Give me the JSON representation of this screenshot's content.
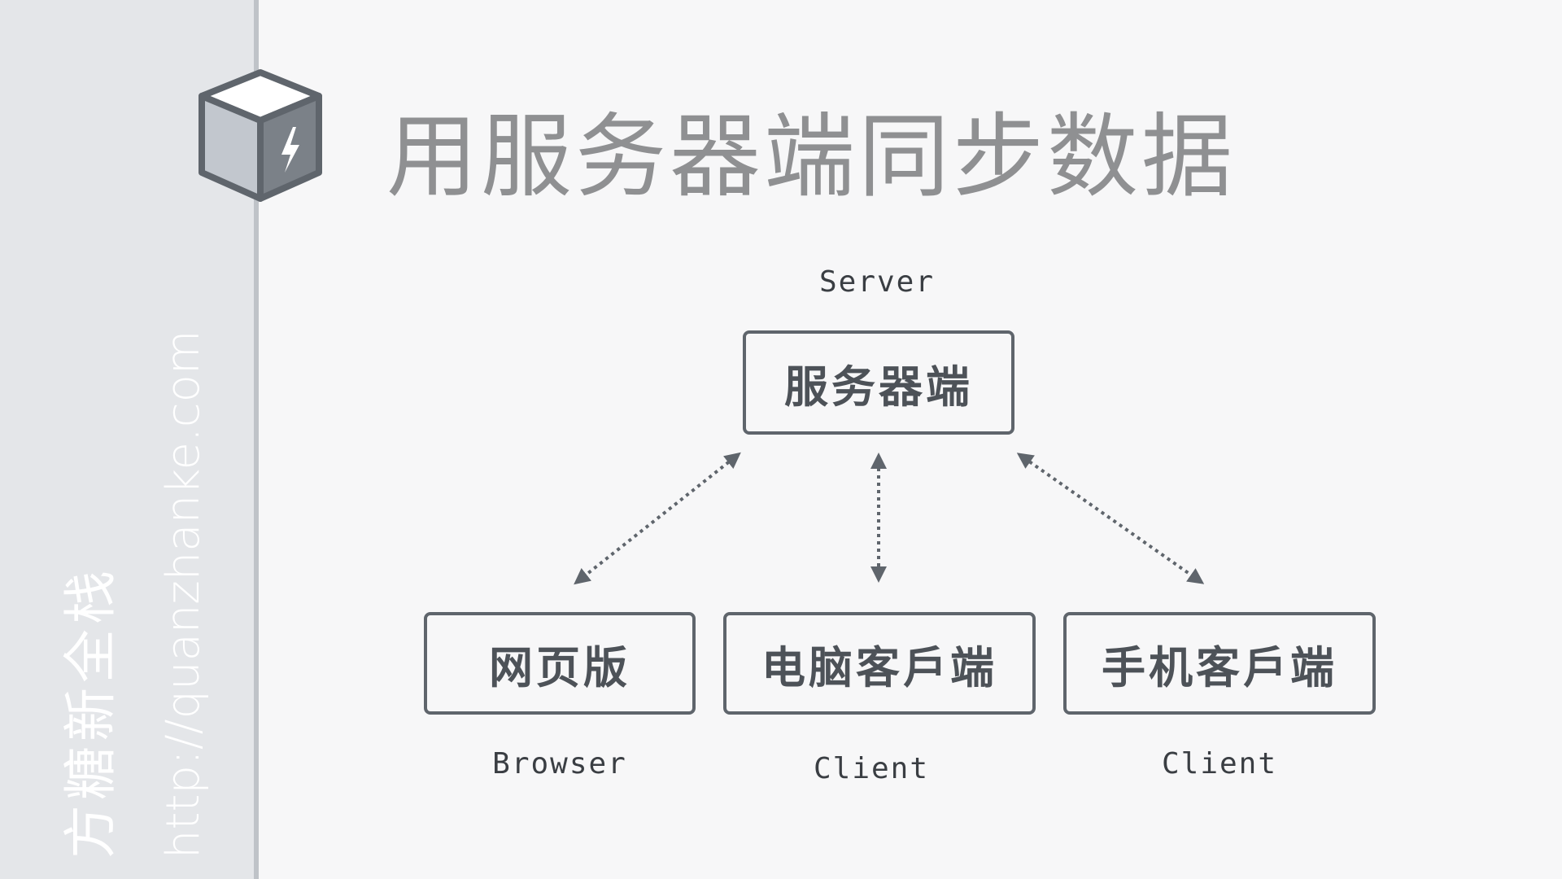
{
  "sidebar": {
    "brand": "方糖新全栈",
    "url": "http://quanzhanke.com"
  },
  "logo": {
    "icon": "lightning-cube-icon"
  },
  "title": "用服务器端同步数据",
  "diagram": {
    "server": {
      "label": "服务器端",
      "caption": "Server"
    },
    "clients": [
      {
        "label": "网页版",
        "caption": "Browser"
      },
      {
        "label": "电脑客戶端",
        "caption": "Client"
      },
      {
        "label": "手机客戶端",
        "caption": "Client"
      }
    ],
    "connections": [
      {
        "from": "服务器端",
        "to": "网页版",
        "style": "dotted",
        "direction": "bidirectional"
      },
      {
        "from": "服务器端",
        "to": "电脑客戶端",
        "style": "dotted",
        "direction": "bidirectional"
      },
      {
        "from": "服务器端",
        "to": "手机客戶端",
        "style": "dotted",
        "direction": "bidirectional"
      }
    ]
  },
  "colors": {
    "stroke": "#5f656c",
    "title": "#8f9092",
    "sidebar": "#e4e6e9"
  }
}
